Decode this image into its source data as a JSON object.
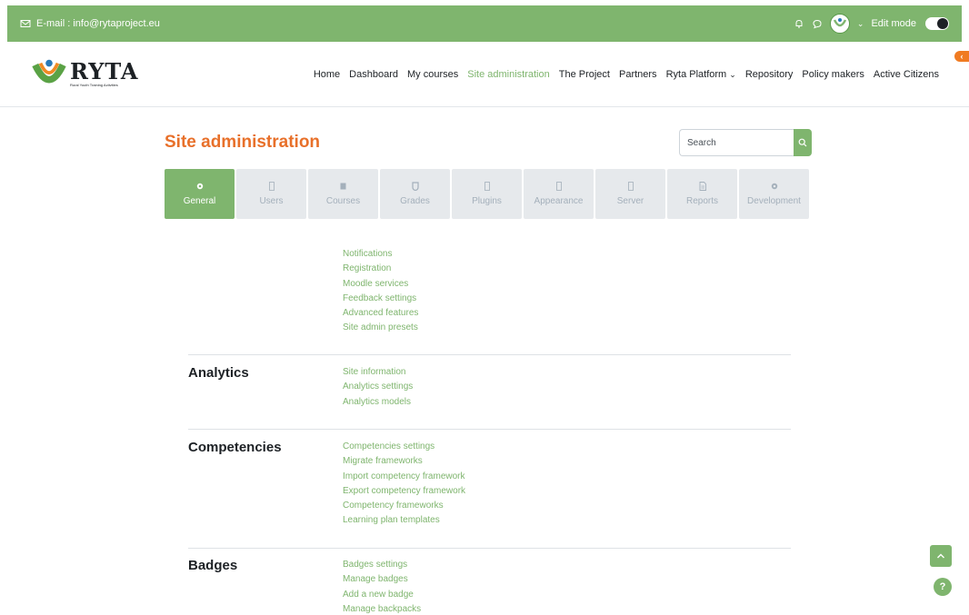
{
  "topbar": {
    "email_label": "E-mail : info@rytaproject.eu",
    "edit_mode_label": "Edit mode"
  },
  "logo": {
    "word": "RYTA",
    "tagline": "Rural Youth Training Activities"
  },
  "nav": {
    "items": [
      "Home",
      "Dashboard",
      "My courses",
      "Site administration",
      "The Project",
      "Partners",
      "Ryta Platform",
      "Repository",
      "Policy makers",
      "Active Citizens"
    ],
    "active": "Site administration"
  },
  "page": {
    "title": "Site administration",
    "search_placeholder": "Search"
  },
  "tabs": [
    {
      "label": "General",
      "icon": "gear-icon"
    },
    {
      "label": "Users",
      "icon": "users-icon"
    },
    {
      "label": "Courses",
      "icon": "courses-icon"
    },
    {
      "label": "Grades",
      "icon": "grades-icon"
    },
    {
      "label": "Plugins",
      "icon": "plugins-icon"
    },
    {
      "label": "Appearance",
      "icon": "appearance-icon"
    },
    {
      "label": "Server",
      "icon": "server-icon"
    },
    {
      "label": "Reports",
      "icon": "reports-icon"
    },
    {
      "label": "Development",
      "icon": "development-icon"
    }
  ],
  "general_links": [
    "Notifications",
    "Registration",
    "Moodle services",
    "Feedback settings",
    "Advanced features",
    "Site admin presets"
  ],
  "sections": {
    "analytics": {
      "heading": "Analytics",
      "links": [
        "Site information",
        "Analytics settings",
        "Analytics models"
      ]
    },
    "competencies": {
      "heading": "Competencies",
      "links": [
        "Competencies settings",
        "Migrate frameworks",
        "Import competency framework",
        "Export competency framework",
        "Competency frameworks",
        "Learning plan templates"
      ]
    },
    "badges": {
      "heading": "Badges",
      "links": [
        "Badges settings",
        "Manage badges",
        "Add a new badge",
        "Manage backpacks"
      ]
    }
  },
  "help": {
    "label": "?"
  },
  "colors": {
    "brand_green": "#7fb56e",
    "title_orange": "#e8702a"
  }
}
